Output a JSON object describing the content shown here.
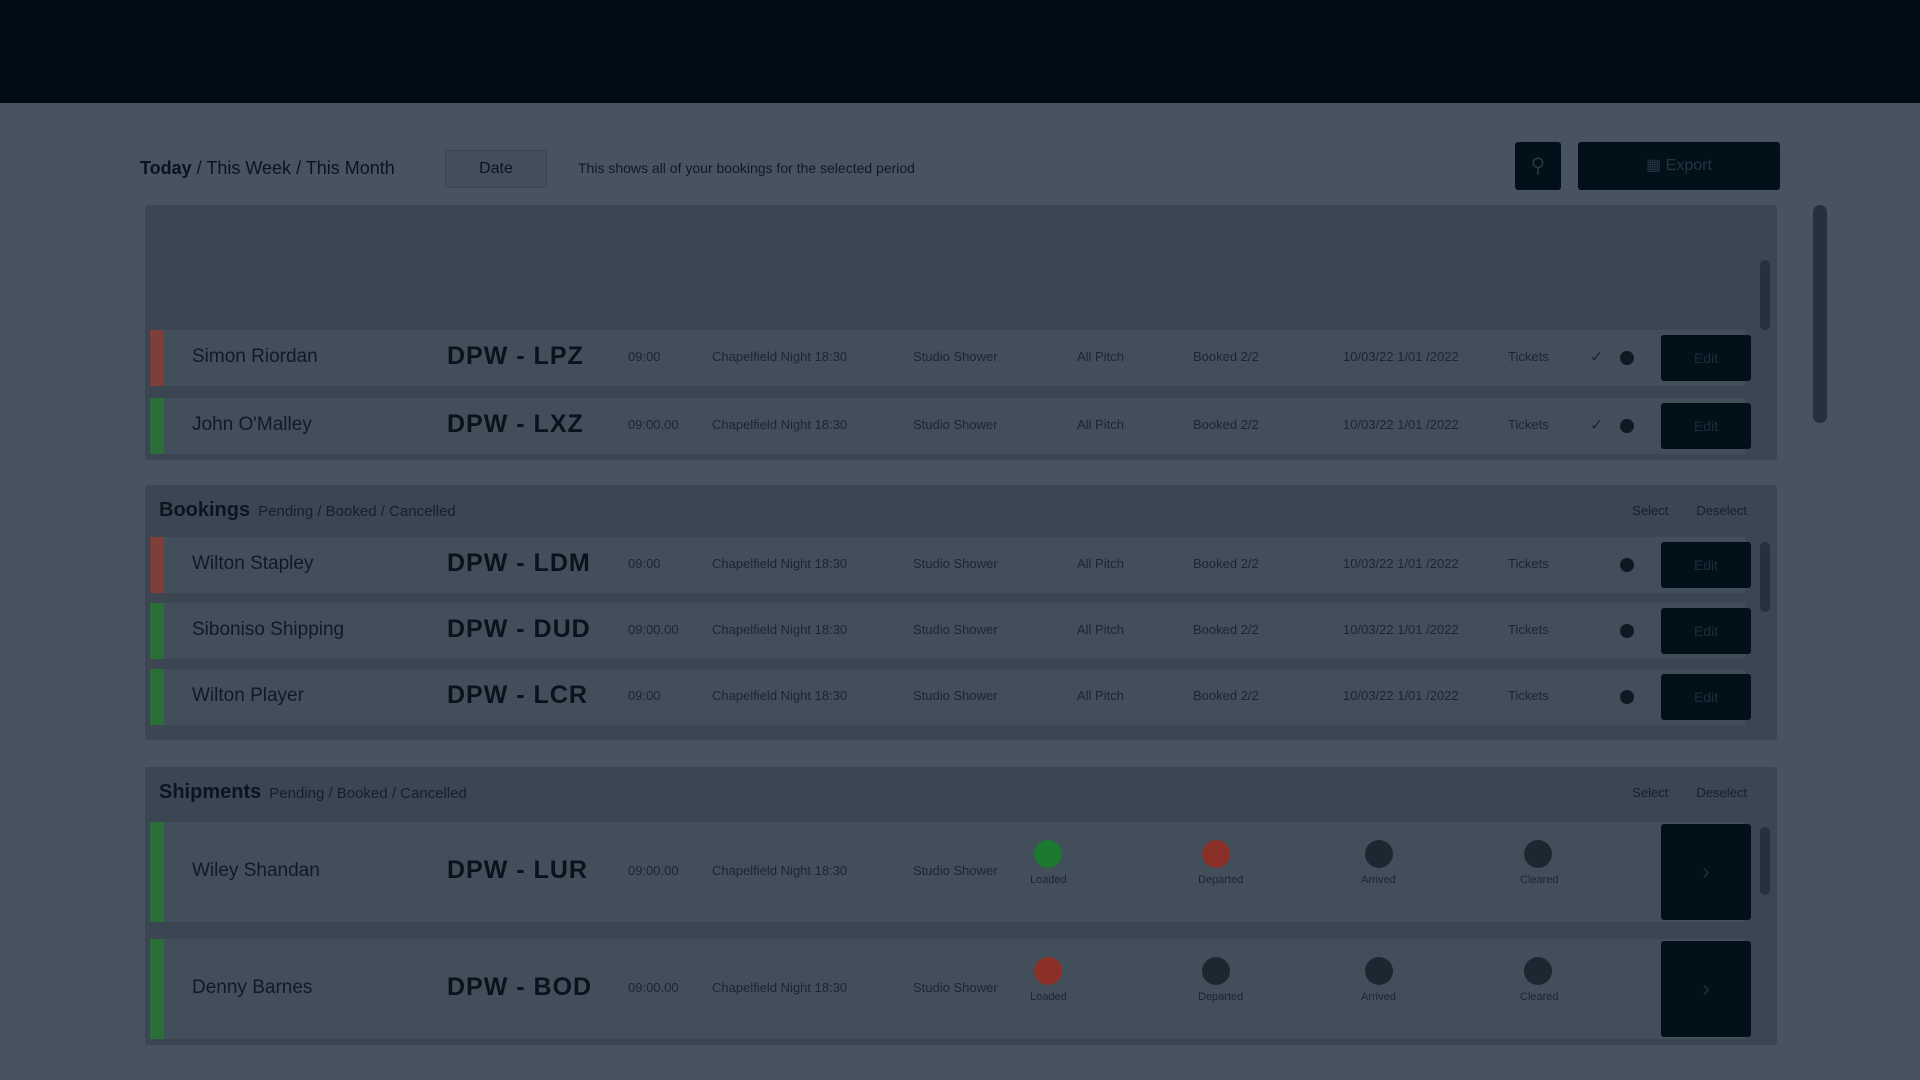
{
  "toolbar": {
    "range_options": [
      "Today",
      "This Week",
      "This Month"
    ],
    "range_separator": " / ",
    "date_value": "Date",
    "description": "This shows all of your bookings for the selected period",
    "search_icon": "search-icon",
    "primary_icon": "calendar-icon",
    "primary_label": "Export"
  },
  "sections": [
    {
      "title": "",
      "subtitle": "",
      "links": [],
      "rows": [
        {
          "status_color": "#7e3f3b",
          "name": "Simon Riordan",
          "code": "DPW - LPZ",
          "time": "09:00",
          "location": "Chapelfield Night 18:30",
          "venue": "Studio Shower",
          "slot1": "All Pitch",
          "slot2": "Booked 2/2",
          "slot3": "10/03/22 1/01 /2022",
          "slot4": "Tickets",
          "checked": true
        },
        {
          "status_color": "#2b6e38",
          "name": "John O'Malley",
          "code": "DPW - LXZ",
          "time": "09:00.00",
          "location": "Chapelfield Night 18:30",
          "venue": "Studio Shower",
          "slot1": "All Pitch",
          "slot2": "Booked 2/2",
          "slot3": "10/03/22 1/01 /2022",
          "slot4": "Tickets",
          "checked": true
        }
      ]
    },
    {
      "title": "Bookings",
      "subtitle": "Pending / Booked / Cancelled",
      "links": [
        "Select",
        "Deselect"
      ],
      "rows": [
        {
          "status_color": "#7e3f3b",
          "name": "Wilton Stapley",
          "code": "DPW - LDM",
          "time": "09:00",
          "location": "Chapelfield Night 18:30",
          "venue": "Studio Shower",
          "slot1": "All Pitch",
          "slot2": "Booked 2/2",
          "slot3": "10/03/22 1/01 /2022",
          "slot4": "Tickets",
          "checked": false
        },
        {
          "status_color": "#2b6e38",
          "name": "Siboniso Shipping",
          "code": "DPW - DUD",
          "time": "09:00.00",
          "location": "Chapelfield Night 18:30",
          "venue": "Studio Shower",
          "slot1": "All Pitch",
          "slot2": "Booked 2/2",
          "slot3": "10/03/22 1/01 /2022",
          "slot4": "Tickets",
          "checked": false
        },
        {
          "status_color": "#2b6e38",
          "name": "Wilton Player",
          "code": "DPW - LCR",
          "time": "09:00",
          "location": "Chapelfield Night 18:30",
          "venue": "Studio Shower",
          "slot1": "All Pitch",
          "slot2": "Booked 2/2",
          "slot3": "10/03/22 1/01 /2022",
          "slot4": "Tickets",
          "checked": false
        }
      ]
    },
    {
      "title": "Shipments",
      "subtitle": "Pending / Booked / Cancelled",
      "links": [
        "Select",
        "Deselect"
      ],
      "stage_labels": [
        "Loaded",
        "Departed",
        "Arrived",
        "Cleared"
      ],
      "rows": [
        {
          "status_color": "#2b6e38",
          "name": "Wiley Shandan",
          "code": "DPW - LUR",
          "time": "09:00.00",
          "location": "Chapelfield Night 18:30",
          "venue": "Studio Shower",
          "stages": [
            "green",
            "red",
            "grey",
            "grey"
          ]
        },
        {
          "status_color": "#2b6e38",
          "name": "Denny Barnes",
          "code": "DPW - BOD",
          "time": "09:00.00",
          "location": "Chapelfield Night 18:30",
          "venue": "Studio Shower",
          "stages": [
            "red",
            "grey",
            "grey",
            "grey"
          ]
        }
      ]
    }
  ],
  "row_action_label": "Edit",
  "row_icon_name": "info-icon",
  "check_icon": "✓",
  "expand_icon": "›"
}
